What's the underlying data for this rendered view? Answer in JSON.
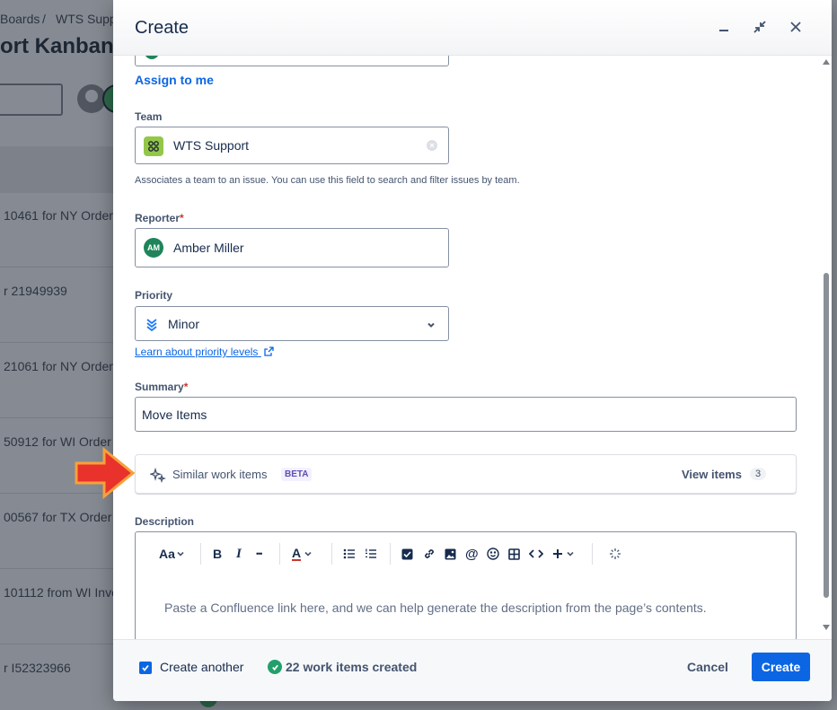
{
  "background": {
    "breadcrumb_a": "Boards",
    "breadcrumb_sep": "/",
    "breadcrumb_b": "WTS Supp",
    "board_title": "ort Kanban",
    "cards": [
      "10461 for NY Order",
      "r 21949939",
      "21061 for NY Order",
      "50912 for WI Order",
      "00567 for TX Order l",
      "101112 from WI Inve",
      "r I52323966"
    ]
  },
  "modal": {
    "title": "Create",
    "header_icons": [
      "minimize-icon",
      "collapse-icon",
      "close-icon"
    ],
    "assign_to_me": "Assign to me",
    "team": {
      "label": "Team",
      "value": "WTS Support",
      "help": "Associates a team to an issue. You can use this field to search and filter issues by team."
    },
    "reporter": {
      "label": "Reporter",
      "required": "*",
      "avatar_initials": "AM",
      "value": "Amber Miller"
    },
    "priority": {
      "label": "Priority",
      "value": "Minor",
      "learn_link": "Learn about priority levels"
    },
    "summary": {
      "label": "Summary",
      "required": "*",
      "value": "Move Items"
    },
    "similar": {
      "label": "Similar work items",
      "badge": "BETA",
      "view_items": "View items",
      "count": "3"
    },
    "description": {
      "label": "Description",
      "toolbar": {
        "text_style": "Aa",
        "bold": "B",
        "italic": "I",
        "more": "•••",
        "color": "A"
      },
      "placeholder": "Paste a Confluence link here, and we can help generate the description from the page’s contents."
    }
  },
  "footer": {
    "create_another": "Create another",
    "created_status": "22 work items created",
    "cancel": "Cancel",
    "create": "Create"
  },
  "colors": {
    "primary": "#0c66e4",
    "success": "#22a06b",
    "required": "#c9372c",
    "annotation_arrow": "#e8322b"
  }
}
